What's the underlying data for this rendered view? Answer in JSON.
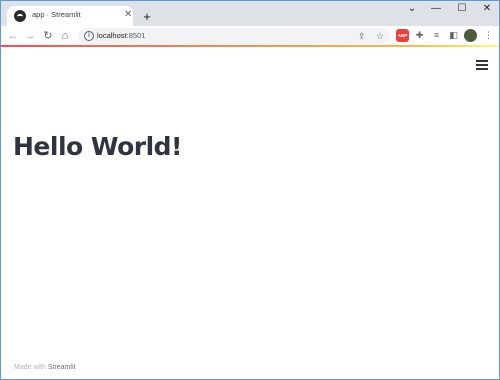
{
  "browser": {
    "tab": {
      "title": "app · Streamlit",
      "close_glyph": "✕",
      "favicon": "streamlit-favicon"
    },
    "new_tab_glyph": "+",
    "window_controls": {
      "chevron": "⌄",
      "minimize": "—",
      "maximize": "☐",
      "close": "✕"
    },
    "nav": {
      "back": "←",
      "forward": "→",
      "reload": "↻",
      "home": "⌂"
    },
    "address": {
      "host": "localhost",
      "port": ":8501",
      "info_glyph": "i",
      "share_glyph": "⇪",
      "star_glyph": "☆"
    },
    "extensions": {
      "abp_label": "ABP",
      "puzzle_glyph": "✚",
      "media_glyph": "≡",
      "sidepanel_glyph": "◧",
      "menu_glyph": "⋮"
    },
    "accent_gradient": [
      "#ff4b4b",
      "#ffbd45",
      "#fffd80"
    ]
  },
  "app": {
    "heading": "Hello World!",
    "footer": {
      "prefix": "Made with",
      "brand": "Streamlit"
    },
    "menu_icon": "hamburger-menu-icon",
    "text_color": "#31333f"
  }
}
